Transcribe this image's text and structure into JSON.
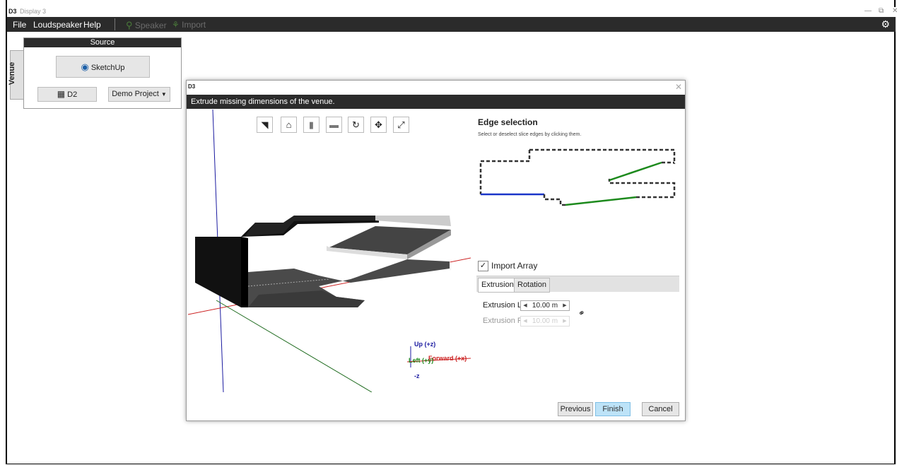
{
  "app": {
    "logo": "D3",
    "title": "Display 3"
  },
  "window_controls": {
    "minimize": "—",
    "restore": "⧉",
    "close": "✕"
  },
  "menu": {
    "file": "File",
    "loudspeaker": "Loudspeaker",
    "help": "Help",
    "speaker": "Speaker",
    "import": "Import"
  },
  "side_tab": {
    "label": "Venue"
  },
  "source": {
    "header": "Source",
    "sketchup": "SketchUp",
    "d2": "D2",
    "project": "Demo Project"
  },
  "dialog": {
    "logo": "D3",
    "header": "Extrude missing dimensions of the venue.",
    "axis_up": "Up (+z)",
    "axis_forward": "Forward (+x)",
    "axis_left": "Left (+y)",
    "axis_down": "-z",
    "edge_title": "Edge selection",
    "edge_sub": "Select or deselect slice edges by clicking them.",
    "import_array": "Import Array",
    "tabs": [
      "Extrusion",
      "Rotation"
    ],
    "extrusion_l_label": "Extrusion L",
    "extrusion_l_value": "10.00 m",
    "extrusion_r_label": "Extrusion R",
    "extrusion_r_value": "10.00 m",
    "previous": "Previous",
    "finish": "Finish",
    "cancel": "Cancel"
  },
  "colors": {
    "dark_bar": "#2b2b2b",
    "edge_blue": "#1a35c9",
    "edge_green": "#1d8a1d",
    "axis_red": "#cc2222",
    "finish_blue": "#bde3f8"
  }
}
